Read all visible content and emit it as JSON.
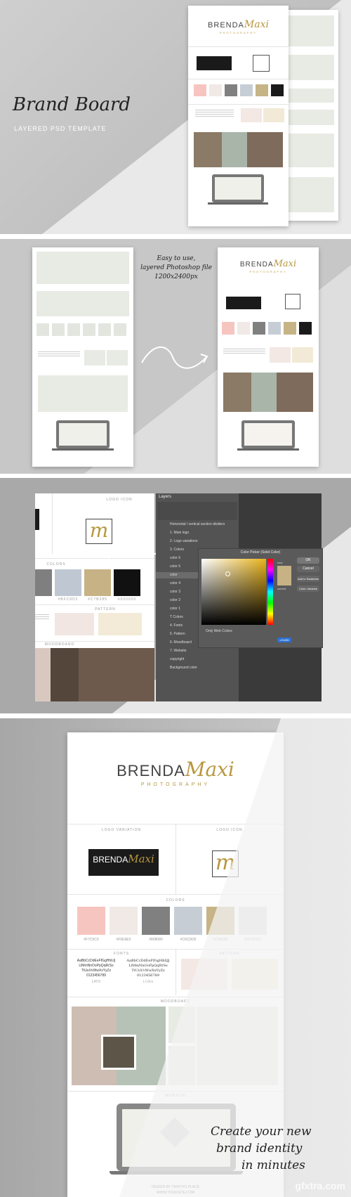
{
  "panel1": {
    "title": "Brand Board",
    "subtitle": "LAYERED PSD TEMPLATE",
    "brand_a": "BRENDA",
    "brand_b": "Maxi",
    "brand_c": "PHOTOGRAPHY"
  },
  "panel2": {
    "note_line1": "Easy to use,",
    "note_line2": "layered Photoshop file",
    "note_line3": "1200x2400px"
  },
  "panel3": {
    "logo_icon_label": "LOGO ICON",
    "colors_label": "COLORS",
    "pattern_label": "PATTERN",
    "moodboard_label": "MOODBOARD",
    "hex1": "#7F7F7F",
    "hex2": "#BFC8D2",
    "hex3": "#C7B285",
    "hex4": "#000000",
    "layers_title": "Layers",
    "layers": [
      "Horizontal / vertical section dividers",
      "1. Main logo",
      "2. Logo variations",
      "3. Colors",
      "color 6",
      "color 5",
      "color",
      "color 4",
      "color 3",
      "color 2",
      "color 1",
      "T Colors",
      "4. Fonts",
      "5. Pattern",
      "6. Moodboard",
      "7. Website",
      "copyright",
      "Background color"
    ],
    "picker_title": "Color Picker (Solid Color)",
    "picker_ok": "OK",
    "picker_cancel": "Cancel",
    "picker_add": "Add to Swatches",
    "picker_lib": "Color Libraries",
    "picker_new": "new",
    "picker_current": "current",
    "only_web": "Only Web Colors",
    "hex_value": "c7b285"
  },
  "panel4": {
    "logo_variation_label": "LOGO VARIATION",
    "logo_icon_label": "LOGO ICON",
    "colors_label": "COLORS",
    "fonts_label": "FONTS",
    "pattern_label": "PATTERN",
    "moodboard_label": "MOODBOARD",
    "website_label": "WEBSITE",
    "hex": [
      "#F7C5C0",
      "#F0E9E5",
      "#808080",
      "#C6CDD5",
      "#C6B386",
      "#DCDCDC"
    ],
    "font1_l1": "AaBbCcDdEeFfGgHhIiJj",
    "font1_l2": "LlMmNnOoPpQqRrSs",
    "font1_l3": "TtUuVvWwXxYyZz",
    "font1_l4": "0123456789",
    "font1_name": "LATO",
    "font2_l1": "AaBbCcDdEeFfGgHhIiJj",
    "font2_l2": "LlMmNnOoPpQqRrSs",
    "font2_l3": "TtUuVvWwXxYyZz",
    "font2_l4": "0123456789",
    "font2_name": "LORA",
    "footer1": "DESIGN BY TANITH'S PLACE",
    "footer2": "WWW.YOURSITE.COM",
    "script1": "Create your new",
    "script2": "brand identity",
    "script3": "in minutes",
    "watermark": "gfxtra.com"
  },
  "colors": {
    "gold": "#b8973f",
    "pink": "#f7c5c0",
    "blush": "#f0e9e5",
    "grey": "#808080",
    "blue": "#c6cdd5",
    "sand": "#c6b386",
    "black": "#1a1a1a",
    "placeholder": "#e8ebe3"
  }
}
